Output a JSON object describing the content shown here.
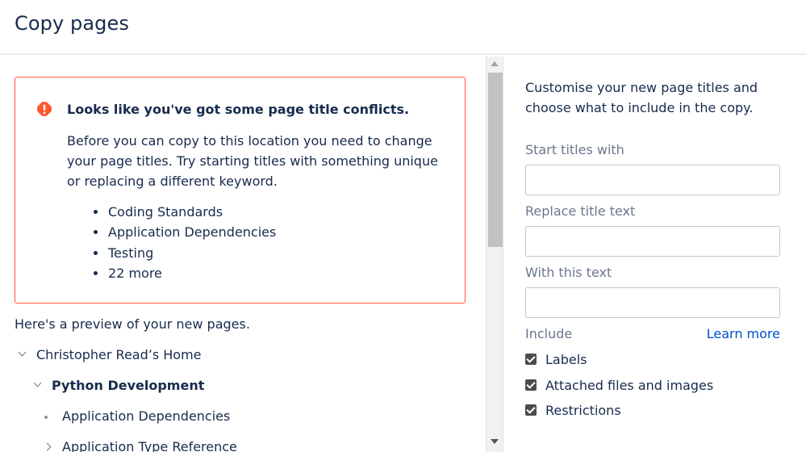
{
  "header": {
    "title": "Copy pages"
  },
  "warning": {
    "title": "Looks like you've got some page title conflicts.",
    "body": "Before you can copy to this location you need to change your page titles. Try starting titles with something unique or replacing a different keyword.",
    "conflicts": [
      "Coding Standards",
      "Application Dependencies",
      "Testing",
      "22 more"
    ],
    "icon": "error-icon",
    "accent_color": "#ff5630"
  },
  "preview": {
    "label": "Here's a preview of your new pages.",
    "tree": [
      {
        "label": "Christopher Read’s Home",
        "toggle": "chevron-down-icon"
      },
      {
        "label": "Python Development",
        "toggle": "chevron-down-icon",
        "bold": true
      },
      {
        "label": "Application Dependencies",
        "toggle": "bullet-icon"
      },
      {
        "label": "Application Type Reference",
        "toggle": "chevron-right-icon"
      }
    ]
  },
  "options": {
    "intro": "Customise your new page titles and choose what to include in the copy.",
    "start_label": "Start titles with",
    "start_value": "",
    "replace_label": "Replace title text",
    "replace_value": "",
    "with_label": "With this text",
    "with_value": "",
    "include_label": "Include",
    "learn_more": "Learn more",
    "checkboxes": [
      {
        "label": "Labels",
        "checked": true
      },
      {
        "label": "Attached files and images",
        "checked": true
      },
      {
        "label": "Restrictions",
        "checked": true
      }
    ],
    "link_color": "#0052cc"
  }
}
